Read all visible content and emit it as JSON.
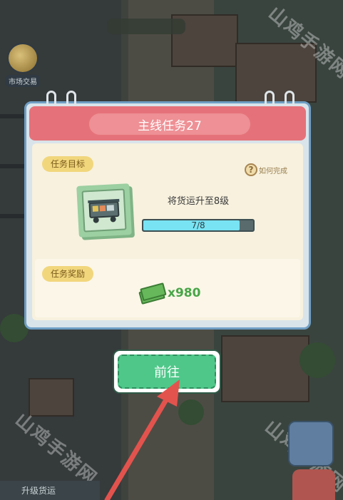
{
  "background": {
    "market_label": "市场交易",
    "bottom_left_label": "升级货运",
    "watermark": "山鸡手游网"
  },
  "dialog": {
    "title": "主线任务27",
    "objective_tag": "任务目标",
    "help_label": "如何完成",
    "help_icon": "?",
    "task_description": "将货运升至8级",
    "progress_text": "7/8",
    "progress_value": 0.875,
    "reward_tag": "任务奖励",
    "reward_amount": "x980",
    "reward_icon": "cash-stack-icon"
  },
  "go_button": {
    "label": "前往"
  },
  "colors": {
    "header": "#e5727a",
    "go_button": "#4fc789",
    "progress_fill": "#78e3f3",
    "arrow": "#e3534e"
  }
}
